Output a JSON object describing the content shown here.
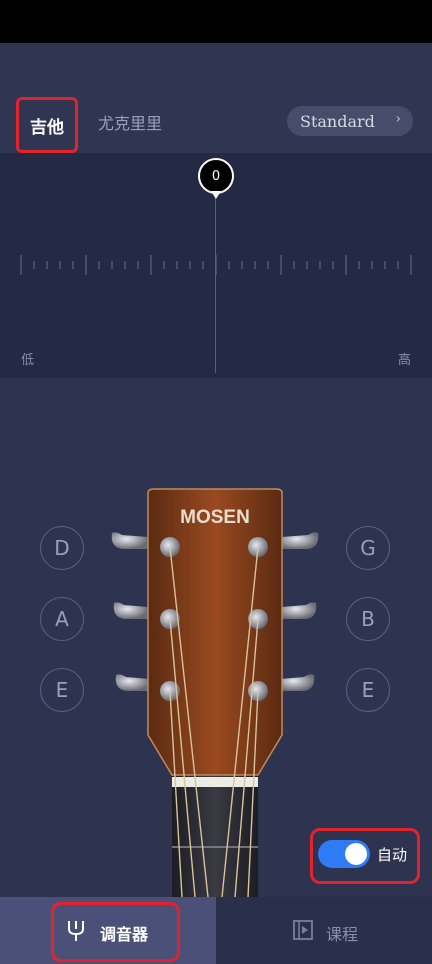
{
  "tabs": {
    "guitar": "吉他",
    "ukulele": "尤克里里"
  },
  "tuning": {
    "label": "Standard",
    "chevron": "›"
  },
  "meter": {
    "pointer_value": "0",
    "low_label": "低",
    "high_label": "高"
  },
  "headstock": {
    "brand": "MOSEN"
  },
  "strings": {
    "left": [
      "D",
      "A",
      "E"
    ],
    "right": [
      "G",
      "B",
      "E"
    ]
  },
  "auto_toggle": {
    "label": "自动",
    "on": true
  },
  "bottom_nav": {
    "tuner": "调音器",
    "course": "课程"
  },
  "colors": {
    "accent": "#2f7bf6",
    "highlight": "#e3232b",
    "background": "#2e3350"
  }
}
